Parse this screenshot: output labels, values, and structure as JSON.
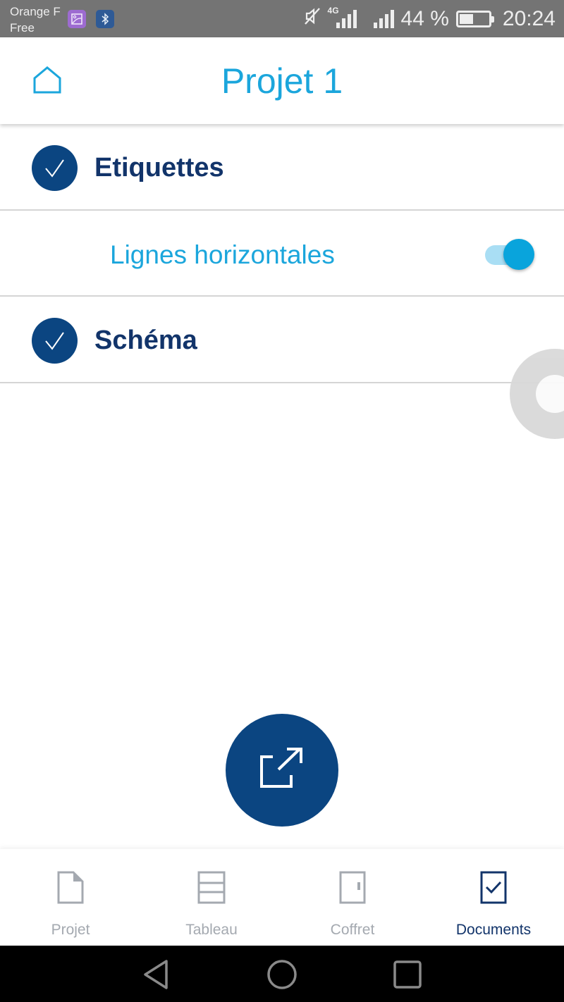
{
  "status_bar": {
    "carrier_line1": "Orange F",
    "carrier_line2": "Free",
    "icons": [
      "gallery-icon",
      "bluetooth-icon",
      "mute-icon",
      "signal-4g-icon",
      "signal-icon",
      "battery-icon"
    ],
    "network_type": "4G",
    "battery_percent_text": "44 %",
    "battery_level": 0.44,
    "time": "20:24"
  },
  "header": {
    "home_icon": "home-icon",
    "title": "Projet 1"
  },
  "list": {
    "items": [
      {
        "label": "Etiquettes",
        "checked": true,
        "icon": "check-circle-icon"
      },
      {
        "label": "Lignes horizontales",
        "toggle_on": true
      },
      {
        "label": "Schéma",
        "checked": true,
        "icon": "check-circle-icon"
      }
    ]
  },
  "fab": {
    "icon": "open-external-icon"
  },
  "bottom_nav": {
    "items": [
      {
        "label": "Projet",
        "icon": "document-icon",
        "active": false
      },
      {
        "label": "Tableau",
        "icon": "table-icon",
        "active": false
      },
      {
        "label": "Coffret",
        "icon": "cabinet-icon",
        "active": false
      },
      {
        "label": "Documents",
        "icon": "checked-document-icon",
        "active": true
      }
    ]
  },
  "colors": {
    "accent": "#1ba6dc",
    "primary_dark": "#0b4581",
    "text_dark": "#12346a",
    "inactive": "#a4a9b0"
  },
  "system_nav": {
    "buttons": [
      "back-icon",
      "home-circle-icon",
      "recents-icon"
    ]
  }
}
